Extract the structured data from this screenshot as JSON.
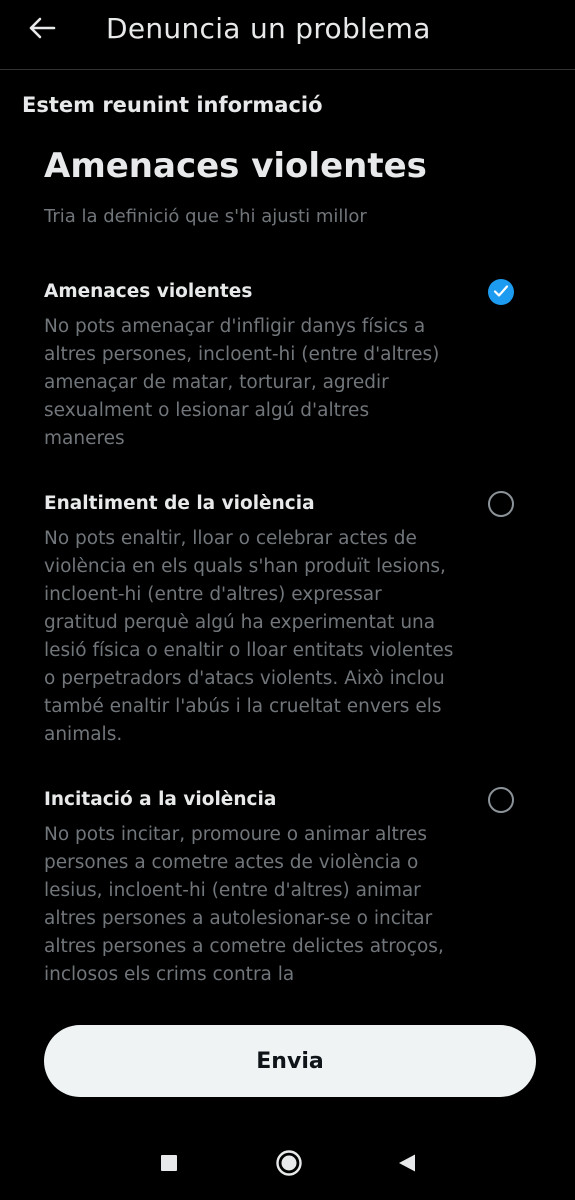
{
  "header": {
    "title": "Denuncia un problema",
    "back_icon": "arrow-left-icon"
  },
  "section_heading": "Estem reunint informació",
  "page": {
    "title": "Amenaces violentes",
    "subtitle": "Tria la definició que s'hi ajusti millor"
  },
  "options": [
    {
      "title": "Amenaces violentes",
      "description": "No pots amenaçar d'infligir danys físics a altres persones, incloent-hi (entre d'altres) amenaçar de matar, torturar, agredir sexualment o lesionar algú d'altres maneres",
      "selected": true
    },
    {
      "title": "Enaltiment de la violència",
      "description": "No pots enaltir, lloar o celebrar actes de violència en els quals s'han produït lesions, incloent-hi (entre d'altres) expressar gratitud perquè algú ha experimentat una lesió física o enaltir o lloar entitats violentes o perpetradors d'atacs violents. Això inclou també enaltir l'abús i la crueltat envers els animals.",
      "selected": false
    },
    {
      "title": "Incitació a la violència",
      "description": "No pots incitar, promoure o animar altres persones a cometre actes de violència o lesius, incloent-hi (entre d'altres) animar altres persones a autolesionar-se o incitar altres persones a cometre delictes atroços, inclosos els crims contra la",
      "selected": false
    }
  ],
  "submit": {
    "label": "Envia"
  },
  "colors": {
    "background": "#000000",
    "accent": "#1d9bf0",
    "text_primary": "#e7e9ea",
    "text_secondary": "#71767b",
    "button_bg": "#eff3f4"
  },
  "system_nav": {
    "recents_icon": "square-icon",
    "home_icon": "circle-home-icon",
    "back_icon": "triangle-back-icon"
  }
}
